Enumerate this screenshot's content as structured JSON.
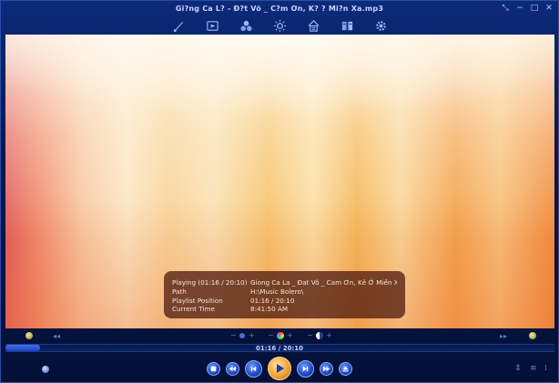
{
  "window": {
    "title": "Gi?ng Ca L? - Đ?t Võ _ C?m Ơn, K? ? Mi?n Xa.mp3",
    "controls": {
      "restore": "⤡",
      "minimize": "−",
      "maximize": "□",
      "close": "✕"
    }
  },
  "toolbar": {
    "icons": [
      "brush-icon",
      "media-icon",
      "effects-icon",
      "brightness-icon",
      "playlist-home-icon",
      "library-icon",
      "settings-icon"
    ]
  },
  "osd": {
    "rows": [
      {
        "key": "Playing (01:16 / 20:10)",
        "value": "Giong Ca La _ Đat Võ _ Cam Ơn, Kẻ Ở Miền Xa"
      },
      {
        "key": "Path",
        "value": "H:\\Music Bolero\\"
      },
      {
        "key": "Playlist Position",
        "value": "01:16 / 20:10"
      },
      {
        "key": "Current Time",
        "value": "8:41:50 AM"
      }
    ]
  },
  "strip": {
    "left_label": "◂◂",
    "right_label": "▸▸",
    "zoom_minus": "−",
    "zoom_plus": "+",
    "color_minus": "−",
    "color_plus": "+",
    "contrast_minus": "−",
    "contrast_plus": "+"
  },
  "playback": {
    "time": "01:16 / 20:10",
    "progress": 0.063
  },
  "transport": {
    "stop": "stop",
    "prev": "previous",
    "rewind": "rewind",
    "play": "play",
    "forward": "forward",
    "next": "next",
    "eject": "eject"
  },
  "colors": {
    "accent": "#2044c8",
    "play": "#f2a43a"
  }
}
